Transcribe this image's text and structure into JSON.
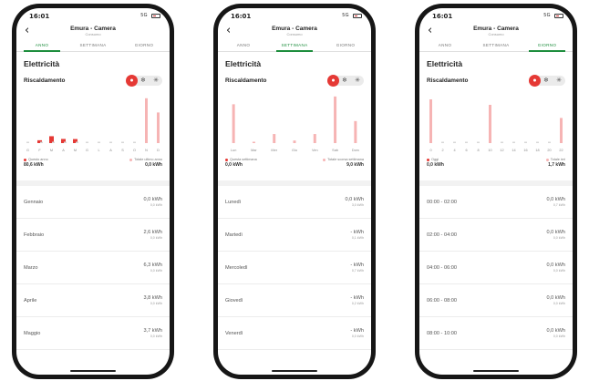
{
  "colors": {
    "accent": "#1e8e3e",
    "bar_current": "#e53935",
    "bar_previous": "#f6b4b4"
  },
  "phones": [
    {
      "status": {
        "time": "16:01",
        "signal": "5G"
      },
      "header": {
        "title": "Emura - Camera",
        "subtitle": "Consumo"
      },
      "tabs": [
        "ANNO",
        "SETTIMANA",
        "GIORNO"
      ],
      "active_tab": 0,
      "section_title": "Elettricità",
      "mode": {
        "label": "Riscaldamento",
        "icons": [
          "flame-icon",
          "snowflake-icon",
          "fan-icon"
        ]
      },
      "chart_data": {
        "type": "bar",
        "categories": [
          "G",
          "F",
          "M",
          "A",
          "M",
          "G",
          "L",
          "A",
          "S",
          "O",
          "N",
          "D"
        ],
        "series": [
          {
            "name": "Questo anno",
            "values": [
              0,
              2.6,
              6.3,
              3.8,
              3.7,
              0,
              0,
              0,
              0,
              0,
              0,
              0
            ]
          },
          {
            "name": "Totale ultimo anno",
            "values": [
              0,
              0,
              0,
              0,
              0,
              0,
              0,
              0,
              0,
              0,
              41,
              28
            ]
          }
        ],
        "ylim": [
          0,
          45
        ]
      },
      "legend": [
        {
          "label": "Questo anno",
          "value": "80,6 kWh"
        },
        {
          "label": "Totale ultimo anno",
          "value": "0,0 kWh"
        }
      ],
      "rows": [
        {
          "label": "Gennaio",
          "value": "0,0 kWh",
          "sub": "0,0 kWh"
        },
        {
          "label": "Febbraio",
          "value": "2,6 kWh",
          "sub": "0,0 kWh"
        },
        {
          "label": "Marzo",
          "value": "6,3 kWh",
          "sub": "0,0 kWh"
        },
        {
          "label": "Aprile",
          "value": "3,8 kWh",
          "sub": "0,0 kWh"
        },
        {
          "label": "Maggio",
          "value": "3,7 kWh",
          "sub": "0,0 kWh"
        }
      ]
    },
    {
      "status": {
        "time": "16:01",
        "signal": "5G"
      },
      "header": {
        "title": "Emura - Camera",
        "subtitle": "Consumo"
      },
      "tabs": [
        "ANNO",
        "SETTIMANA",
        "GIORNO"
      ],
      "active_tab": 1,
      "section_title": "Elettricità",
      "mode": {
        "label": "Riscaldamento",
        "icons": [
          "flame-icon",
          "snowflake-icon",
          "fan-icon"
        ]
      },
      "chart_data": {
        "type": "bar",
        "categories": [
          "Lun",
          "Mar",
          "Mer",
          "Gio",
          "Ven",
          "Sab",
          "Dom"
        ],
        "series": [
          {
            "name": "Questa settimana",
            "values": [
              0,
              0,
              0,
              0,
              0,
              0,
              0
            ]
          },
          {
            "name": "Totale scorsa settimana",
            "values": [
              3.0,
              0.1,
              0.7,
              0.2,
              0.7,
              3.6,
              1.7
            ]
          }
        ],
        "ylim": [
          0,
          3.8
        ]
      },
      "legend": [
        {
          "label": "Questa settimana",
          "value": "0,0 kWh"
        },
        {
          "label": "Totale scorsa settimana",
          "value": "9,0 kWh"
        }
      ],
      "rows": [
        {
          "label": "Lunedì",
          "value": "0,0 kWh",
          "sub": "3,0 kWh"
        },
        {
          "label": "Martedì",
          "value": "- kWh",
          "sub": "0,1 kWh"
        },
        {
          "label": "Mercoledì",
          "value": "- kWh",
          "sub": "0,7 kWh"
        },
        {
          "label": "Giovedì",
          "value": "- kWh",
          "sub": "0,2 kWh"
        },
        {
          "label": "Venerdì",
          "value": "- kWh",
          "sub": "0,0 kWh"
        }
      ]
    },
    {
      "status": {
        "time": "16:01",
        "signal": "5G"
      },
      "header": {
        "title": "Emura - Camera",
        "subtitle": "Consumo"
      },
      "tabs": [
        "ANNO",
        "SETTIMANA",
        "GIORNO"
      ],
      "active_tab": 2,
      "section_title": "Elettricità",
      "mode": {
        "label": "Riscaldamento",
        "icons": [
          "flame-icon",
          "snowflake-icon",
          "fan-icon"
        ]
      },
      "chart_data": {
        "type": "bar",
        "categories": [
          "0",
          "2",
          "4",
          "6",
          "8",
          "10",
          "12",
          "14",
          "16",
          "18",
          "20",
          "22"
        ],
        "series": [
          {
            "name": "Oggi",
            "values": [
              0,
              0,
              0,
              0,
              0,
              0,
              0,
              0,
              0,
              0,
              0,
              0
            ]
          },
          {
            "name": "Totale ieri",
            "values": [
              0.4,
              0,
              0,
              0,
              0,
              0.35,
              0,
              0,
              0,
              0,
              0,
              0.23
            ]
          }
        ],
        "ylim": [
          0,
          0.45
        ]
      },
      "legend": [
        {
          "label": "Oggi",
          "value": "0,0 kWh"
        },
        {
          "label": "Totale ieri",
          "value": "1,7 kWh"
        }
      ],
      "rows": [
        {
          "label": "00:00 - 02:00",
          "value": "0,0 kWh",
          "sub": "0,7 kWh"
        },
        {
          "label": "02:00 - 04:00",
          "value": "0,0 kWh",
          "sub": "0,0 kWh"
        },
        {
          "label": "04:00 - 06:00",
          "value": "0,0 kWh",
          "sub": "0,0 kWh"
        },
        {
          "label": "06:00 - 08:00",
          "value": "0,0 kWh",
          "sub": "0,0 kWh"
        },
        {
          "label": "08:00 - 10:00",
          "value": "0,0 kWh",
          "sub": "0,0 kWh"
        }
      ]
    }
  ]
}
